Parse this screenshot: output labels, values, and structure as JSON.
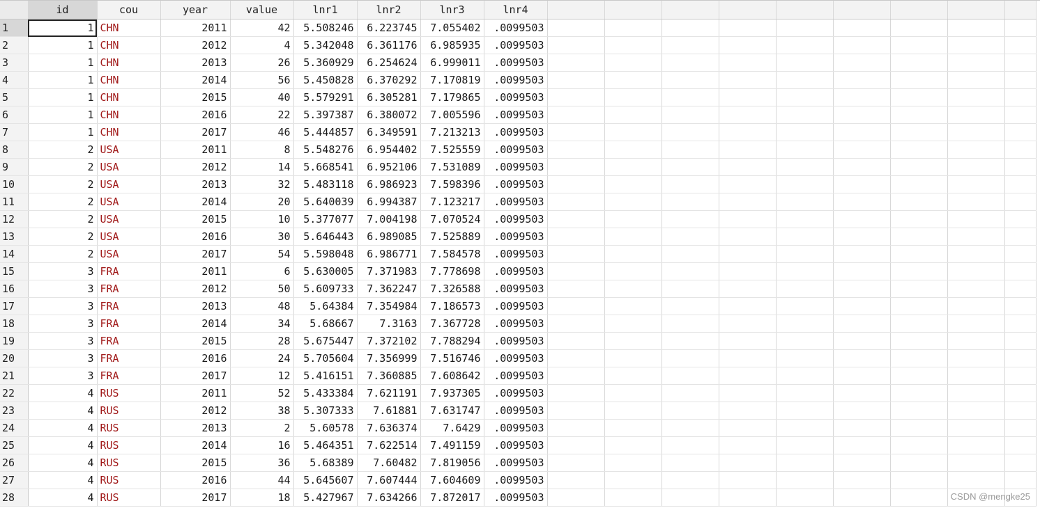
{
  "columns": [
    "id",
    "cou",
    "year",
    "value",
    "lnr1",
    "lnr2",
    "lnr3",
    "lnr4"
  ],
  "string_columns": [
    "cou"
  ],
  "selected_column": "id",
  "active_row": 1,
  "colors": {
    "string_text": "#a01818",
    "header_bg": "#f3f3f3",
    "selected_header_bg": "#d7d7d7"
  },
  "rows": [
    [
      "1",
      "CHN",
      "2011",
      "42",
      "5.508246",
      "6.223745",
      "7.055402",
      ".0099503"
    ],
    [
      "1",
      "CHN",
      "2012",
      "4",
      "5.342048",
      "6.361176",
      "6.985935",
      ".0099503"
    ],
    [
      "1",
      "CHN",
      "2013",
      "26",
      "5.360929",
      "6.254624",
      "6.999011",
      ".0099503"
    ],
    [
      "1",
      "CHN",
      "2014",
      "56",
      "5.450828",
      "6.370292",
      "7.170819",
      ".0099503"
    ],
    [
      "1",
      "CHN",
      "2015",
      "40",
      "5.579291",
      "6.305281",
      "7.179865",
      ".0099503"
    ],
    [
      "1",
      "CHN",
      "2016",
      "22",
      "5.397387",
      "6.380072",
      "7.005596",
      ".0099503"
    ],
    [
      "1",
      "CHN",
      "2017",
      "46",
      "5.444857",
      "6.349591",
      "7.213213",
      ".0099503"
    ],
    [
      "2",
      "USA",
      "2011",
      "8",
      "5.548276",
      "6.954402",
      "7.525559",
      ".0099503"
    ],
    [
      "2",
      "USA",
      "2012",
      "14",
      "5.668541",
      "6.952106",
      "7.531089",
      ".0099503"
    ],
    [
      "2",
      "USA",
      "2013",
      "32",
      "5.483118",
      "6.986923",
      "7.598396",
      ".0099503"
    ],
    [
      "2",
      "USA",
      "2014",
      "20",
      "5.640039",
      "6.994387",
      "7.123217",
      ".0099503"
    ],
    [
      "2",
      "USA",
      "2015",
      "10",
      "5.377077",
      "7.004198",
      "7.070524",
      ".0099503"
    ],
    [
      "2",
      "USA",
      "2016",
      "30",
      "5.646443",
      "6.989085",
      "7.525889",
      ".0099503"
    ],
    [
      "2",
      "USA",
      "2017",
      "54",
      "5.598048",
      "6.986771",
      "7.584578",
      ".0099503"
    ],
    [
      "3",
      "FRA",
      "2011",
      "6",
      "5.630005",
      "7.371983",
      "7.778698",
      ".0099503"
    ],
    [
      "3",
      "FRA",
      "2012",
      "50",
      "5.609733",
      "7.362247",
      "7.326588",
      ".0099503"
    ],
    [
      "3",
      "FRA",
      "2013",
      "48",
      "5.64384",
      "7.354984",
      "7.186573",
      ".0099503"
    ],
    [
      "3",
      "FRA",
      "2014",
      "34",
      "5.68667",
      "7.3163",
      "7.367728",
      ".0099503"
    ],
    [
      "3",
      "FRA",
      "2015",
      "28",
      "5.675447",
      "7.372102",
      "7.788294",
      ".0099503"
    ],
    [
      "3",
      "FRA",
      "2016",
      "24",
      "5.705604",
      "7.356999",
      "7.516746",
      ".0099503"
    ],
    [
      "3",
      "FRA",
      "2017",
      "12",
      "5.416151",
      "7.360885",
      "7.608642",
      ".0099503"
    ],
    [
      "4",
      "RUS",
      "2011",
      "52",
      "5.433384",
      "7.621191",
      "7.937305",
      ".0099503"
    ],
    [
      "4",
      "RUS",
      "2012",
      "38",
      "5.307333",
      "7.61881",
      "7.631747",
      ".0099503"
    ],
    [
      "4",
      "RUS",
      "2013",
      "2",
      "5.60578",
      "7.636374",
      "7.6429",
      ".0099503"
    ],
    [
      "4",
      "RUS",
      "2014",
      "16",
      "5.464351",
      "7.622514",
      "7.491159",
      ".0099503"
    ],
    [
      "4",
      "RUS",
      "2015",
      "36",
      "5.68389",
      "7.60482",
      "7.819056",
      ".0099503"
    ],
    [
      "4",
      "RUS",
      "2016",
      "44",
      "5.645607",
      "7.607444",
      "7.604609",
      ".0099503"
    ],
    [
      "4",
      "RUS",
      "2017",
      "18",
      "5.427967",
      "7.634266",
      "7.872017",
      ".0099503"
    ]
  ],
  "watermark": "CSDN @mengke25"
}
